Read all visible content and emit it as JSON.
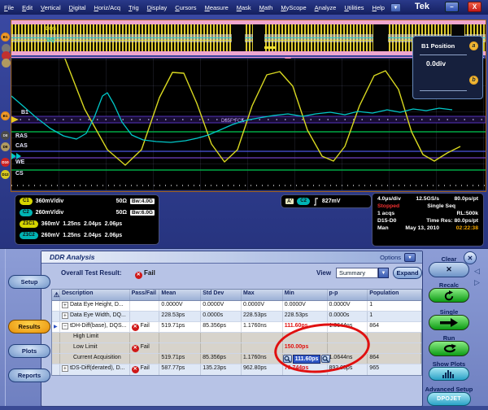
{
  "menu": {
    "items": [
      "File",
      "Edit",
      "Vertical",
      "Digital",
      "Horiz/Acq",
      "Trig",
      "Display",
      "Cursors",
      "Measure",
      "Mask",
      "Math",
      "MyScope",
      "Analyze",
      "Utilities",
      "Help"
    ],
    "brand": "Tek"
  },
  "scope": {
    "overview": {
      "dqs_label": "DQS",
      "dq_label": "DQ"
    },
    "b1_panel": {
      "title": "B1 Position",
      "value": "0.0div",
      "knob_a": "a",
      "knob_b": "b"
    },
    "signals": {
      "labels": [
        "B1",
        "RAS",
        "CAS",
        "WE",
        "CS"
      ],
      "badges": [
        "B1",
        "D8",
        "D9",
        "D10",
        "D12"
      ],
      "bus_value": "D85F FCE"
    },
    "readouts": [
      {
        "badge": "C1",
        "scale": "360mV/div",
        "term": "50Ω",
        "bw": "Bw:4.0G"
      },
      {
        "badge": "C2",
        "scale": "260mV/div",
        "term": "50Ω",
        "bw": "Bw:6.0G"
      },
      {
        "badge": "Z1C1",
        "scale": "360mV",
        "f1": "1.25ns",
        "f2": "2.04µs",
        "f3": "2.06µs"
      },
      {
        "badge": "Z1C2",
        "scale": "260mV",
        "f1": "1.25ns",
        "f2": "2.04µs",
        "f3": "2.06µs"
      }
    ],
    "trigger": {
      "marker": "A'",
      "source": "C2",
      "level": "827mV"
    },
    "timebase": {
      "scale": "4.0µs/div",
      "rate": "12.5GS/s",
      "res": "80.0ps/pt",
      "state": "Stopped",
      "mode": "Single Seq",
      "acqs": "1 acqs",
      "rl": "RL:500k",
      "bus": "D15-D0",
      "timeres": "Time Res: 80.0ps/pt",
      "man": "Man",
      "date": "May 13, 2010",
      "time": "02:22:38"
    }
  },
  "ddr": {
    "title": "DDR Analysis",
    "options_label": "Options",
    "sidebar": {
      "setup": "Setup",
      "results": "Results",
      "plots": "Plots",
      "reports": "Reports"
    },
    "overall_label": "Overall Test Result:",
    "overall_value": "Fail",
    "view_label": "View",
    "view_value": "Summary",
    "expand_label": "Expand",
    "table": {
      "headers": [
        "Description",
        "Pass/Fail",
        "Mean",
        "Std Dev",
        "Max",
        "Min",
        "p-p",
        "Population"
      ],
      "rows": [
        {
          "expand": "+",
          "desc": "Data Eye Height, D...",
          "pass": "",
          "mean": "0.0000V",
          "std": "0.0000V",
          "max": "0.0000V",
          "min": "0.0000V",
          "pp": "0.0000V",
          "pop": "1"
        },
        {
          "expand": "+",
          "desc": "Data Eye Width, DQ...",
          "pass": "",
          "mean": "228.53ps",
          "std": "0.0000s",
          "max": "228.53ps",
          "min": "228.53ps",
          "pp": "0.0000s",
          "pop": "1"
        },
        {
          "expand": "−",
          "desc": "tDH-Diff(base), DQS...",
          "pass": "Fail",
          "mean": "519.71ps",
          "std": "85.356ps",
          "max": "1.1760ns",
          "min": "111.60ps",
          "pp": "1.0644ns",
          "pop": "864"
        },
        {
          "desc": "High Limit",
          "pass": "",
          "mean": "",
          "std": "",
          "max": "",
          "min": "",
          "pp": "",
          "pop": ""
        },
        {
          "desc": "Low Limit",
          "pass": "Fail",
          "mean": "",
          "std": "",
          "max": "",
          "min": "150.00ps",
          "pp": "",
          "pop": ""
        },
        {
          "desc": "Current Acquisition",
          "pass": "",
          "mean": "519.71ps",
          "std": "85.356ps",
          "max": "1.1760ns",
          "min": "111.60ps",
          "pp": "1.0644ns",
          "pop": "864"
        },
        {
          "expand": "+",
          "desc": "tDS-Diff(derated), D...",
          "pass": "Fail",
          "mean": "587.77ps",
          "std": "135.23ps",
          "max": "962.80ps",
          "min": "70.744ps",
          "pp": "892.05ps",
          "pop": "965"
        }
      ]
    },
    "controls": {
      "clear": "Clear",
      "recalc": "Recalc",
      "single": "Single",
      "run": "Run",
      "show_plots": "Show Plots",
      "advanced": "Advanced Setup",
      "dpojet": "DPOJET"
    }
  },
  "colors": {
    "fail_red": "#cf1717",
    "min_red": "#e01010",
    "highlight_blue": "#2f55c4",
    "c1_yellow": "#d6d600",
    "c2_cyan": "#00b4b4",
    "results_orange": "#e8900a"
  }
}
